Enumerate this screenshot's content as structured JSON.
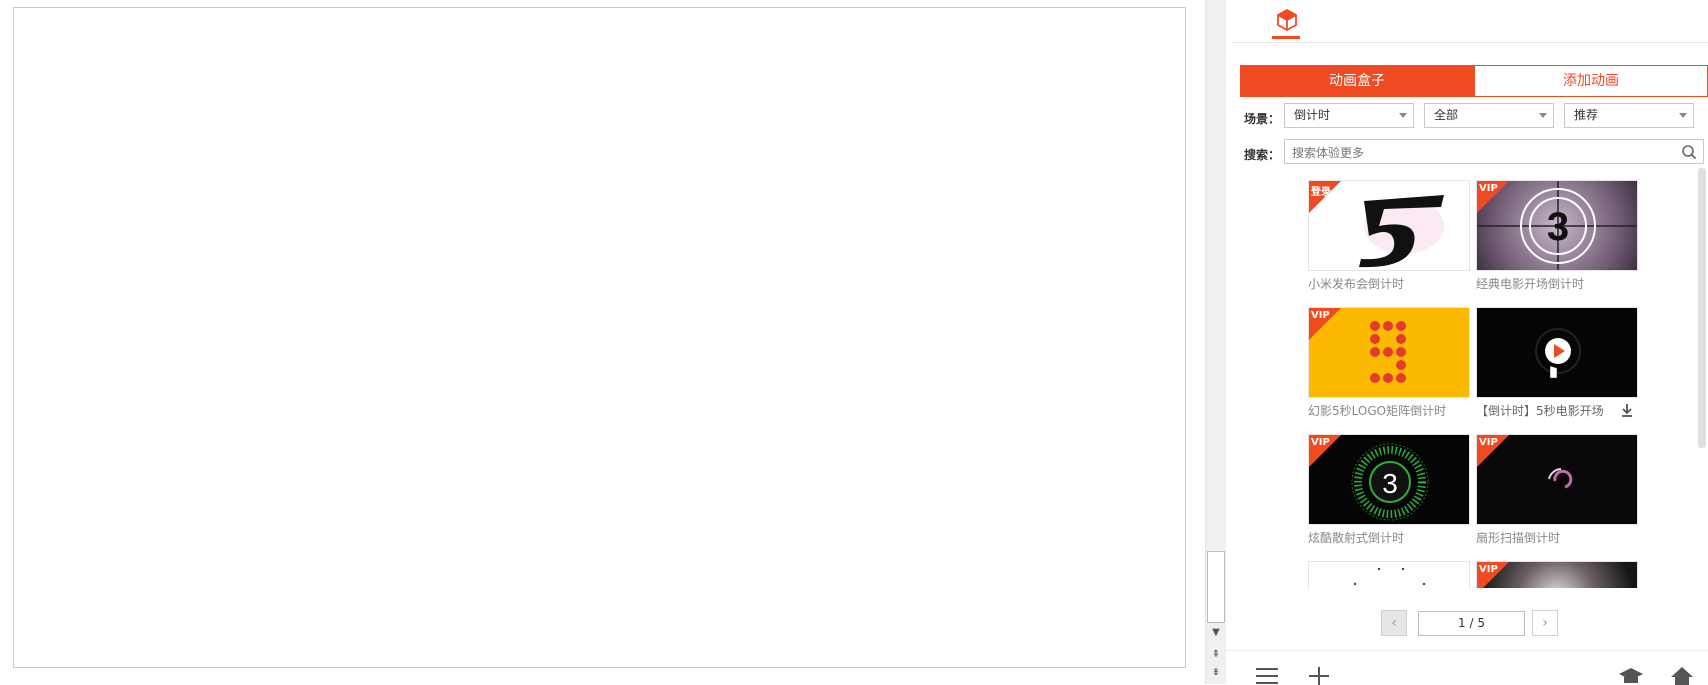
{
  "toolbar": {
    "panel_icon": "cube-icon"
  },
  "segmented": {
    "tab1": "动画盒子",
    "tab2": "添加动画"
  },
  "filters": {
    "scene_label": "场景：",
    "scene_value": "倒计时",
    "type_value": "全部",
    "sort_value": "推荐",
    "search_label": "搜索：",
    "search_placeholder": "搜索体验更多"
  },
  "cards": [
    {
      "title": "小米发布会倒计时",
      "badge": "登录"
    },
    {
      "title": "经典电影开场倒计时",
      "badge": "VIP"
    },
    {
      "title": "幻影5秒LOGO矩阵倒计时",
      "badge": "VIP"
    },
    {
      "title": "【倒计时】5秒电影开场",
      "badge": ""
    },
    {
      "title": "炫酷散射式倒计时",
      "badge": "VIP"
    },
    {
      "title": "扇形扫描倒计时",
      "badge": "VIP"
    },
    {
      "title": "",
      "badge": ""
    },
    {
      "title": "",
      "badge": "VIP"
    }
  ],
  "pagination": {
    "page": "1 / 5"
  },
  "colors": {
    "accent": "#f04a23"
  },
  "bottom_icons": [
    "menu-icon",
    "plus-icon",
    "graduation-cap-icon",
    "home-icon"
  ]
}
